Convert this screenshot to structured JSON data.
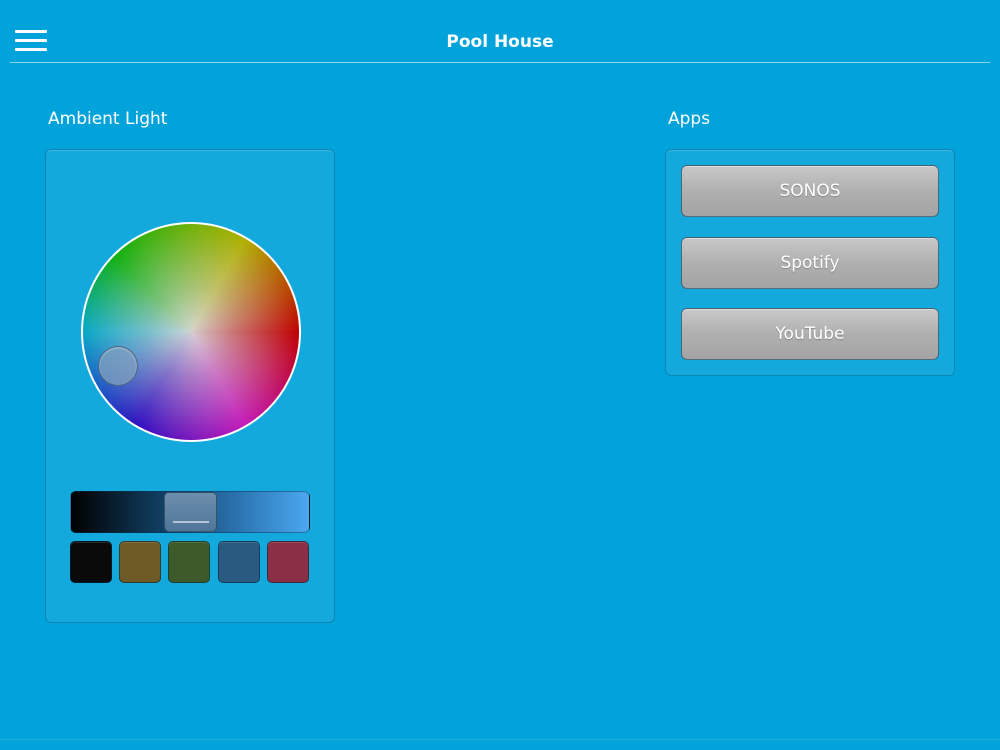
{
  "header": {
    "title": "Pool House",
    "menu_icon": "hamburger-menu-icon"
  },
  "ambient_light": {
    "label": "Ambient Light",
    "brightness_fraction": 0.5,
    "swatches": [
      {
        "name": "black",
        "color": "#0a0a0a"
      },
      {
        "name": "olive",
        "color": "#6e5a25"
      },
      {
        "name": "green",
        "color": "#3d5b2a"
      },
      {
        "name": "blue",
        "color": "#2b5a80"
      },
      {
        "name": "red",
        "color": "#8a2f45"
      }
    ]
  },
  "apps": {
    "label": "Apps",
    "buttons": [
      {
        "label": "SONOS"
      },
      {
        "label": "Spotify"
      },
      {
        "label": "YouTube"
      }
    ]
  },
  "colors": {
    "background": "#02a3da",
    "button_gray": "#b0b0b0"
  }
}
